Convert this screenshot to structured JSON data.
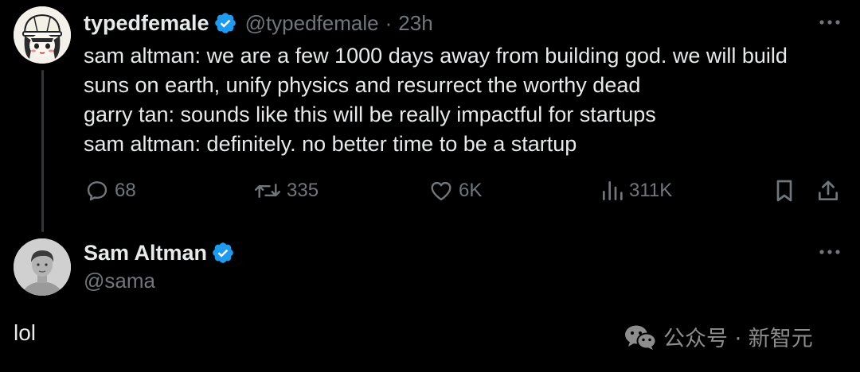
{
  "tweet": {
    "author_name": "typedfemale",
    "author_handle": "@typedfemale",
    "separator": "·",
    "time": "23h",
    "text_lines": [
      "sam altman: we are a few 1000 days away from building god. we will build",
      "suns on earth, unify physics and resurrect the worthy dead",
      "garry tan: sounds like this will be really impactful for startups",
      "sam altman: definitely. no better time to be a startup"
    ],
    "actions": {
      "replies": "68",
      "reposts": "335",
      "likes": "6K",
      "views": "311K"
    }
  },
  "reply": {
    "author_name": "Sam Altman",
    "author_handle": "@sama",
    "text": "lol"
  },
  "watermark": {
    "text": "公众号 · 新智元"
  },
  "colors": {
    "background": "#000000",
    "primary_text": "#e7e9ea",
    "secondary_text": "#71767b",
    "verified_badge": "#1d9bf0",
    "thread_line": "#333639"
  },
  "icons": [
    "verified-badge-icon",
    "more-icon",
    "reply-icon",
    "repost-icon",
    "like-icon",
    "views-icon",
    "bookmark-icon",
    "share-icon",
    "wechat-icon"
  ]
}
